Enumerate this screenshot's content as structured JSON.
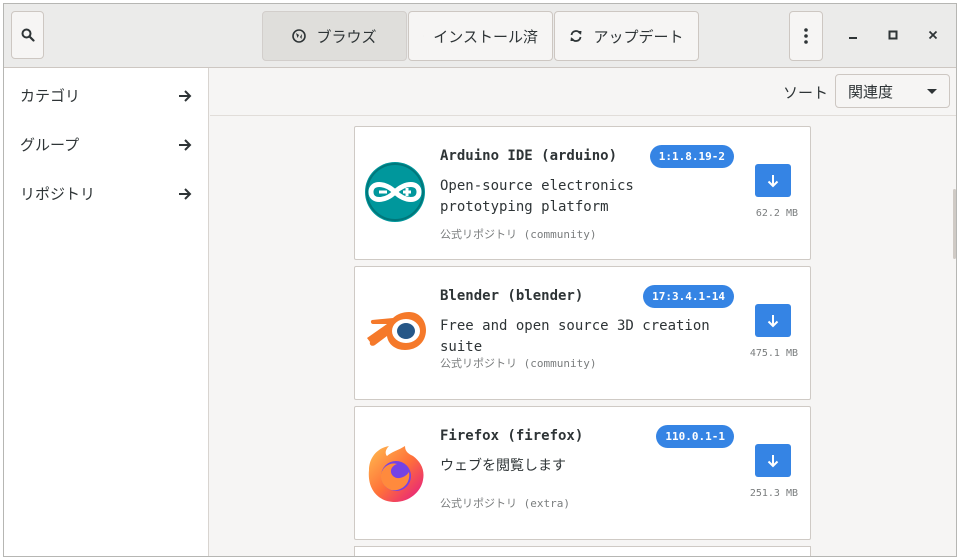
{
  "header": {
    "search_icon": "search-icon",
    "tabs": [
      {
        "label": "ブラウズ",
        "icon": "globe-icon"
      },
      {
        "label": "インストール済",
        "icon": "list-icon"
      },
      {
        "label": "アップデート",
        "icon": "refresh-icon"
      }
    ],
    "menu_icon": "vertical-dots-icon"
  },
  "sidebar": {
    "items": [
      {
        "label": "カテゴリ"
      },
      {
        "label": "グループ"
      },
      {
        "label": "リポジトリ"
      }
    ]
  },
  "sort": {
    "label": "ソート",
    "value": "関連度"
  },
  "packages": [
    {
      "title": "Arduino IDE (arduino)",
      "version": "1:1.8.19-2",
      "description": "Open-source electronics prototyping platform",
      "repo": "公式リポジトリ (community)",
      "size": "62.2 MB",
      "icon": "arduino-icon",
      "color": "#00979c"
    },
    {
      "title": "Blender (blender)",
      "version": "17:3.4.1-14",
      "description": "Free and open source 3D creation suite",
      "repo": "公式リポジトリ (community)",
      "size": "475.1 MB",
      "icon": "blender-icon",
      "color": "#f5792a"
    },
    {
      "title": "Firefox (firefox)",
      "version": "110.0.1-1",
      "description": "ウェブを閲覧します",
      "repo": "公式リポジトリ (extra)",
      "size": "251.3 MB",
      "icon": "firefox-icon",
      "color": "#ff7139"
    }
  ],
  "accent": "#3584e4"
}
